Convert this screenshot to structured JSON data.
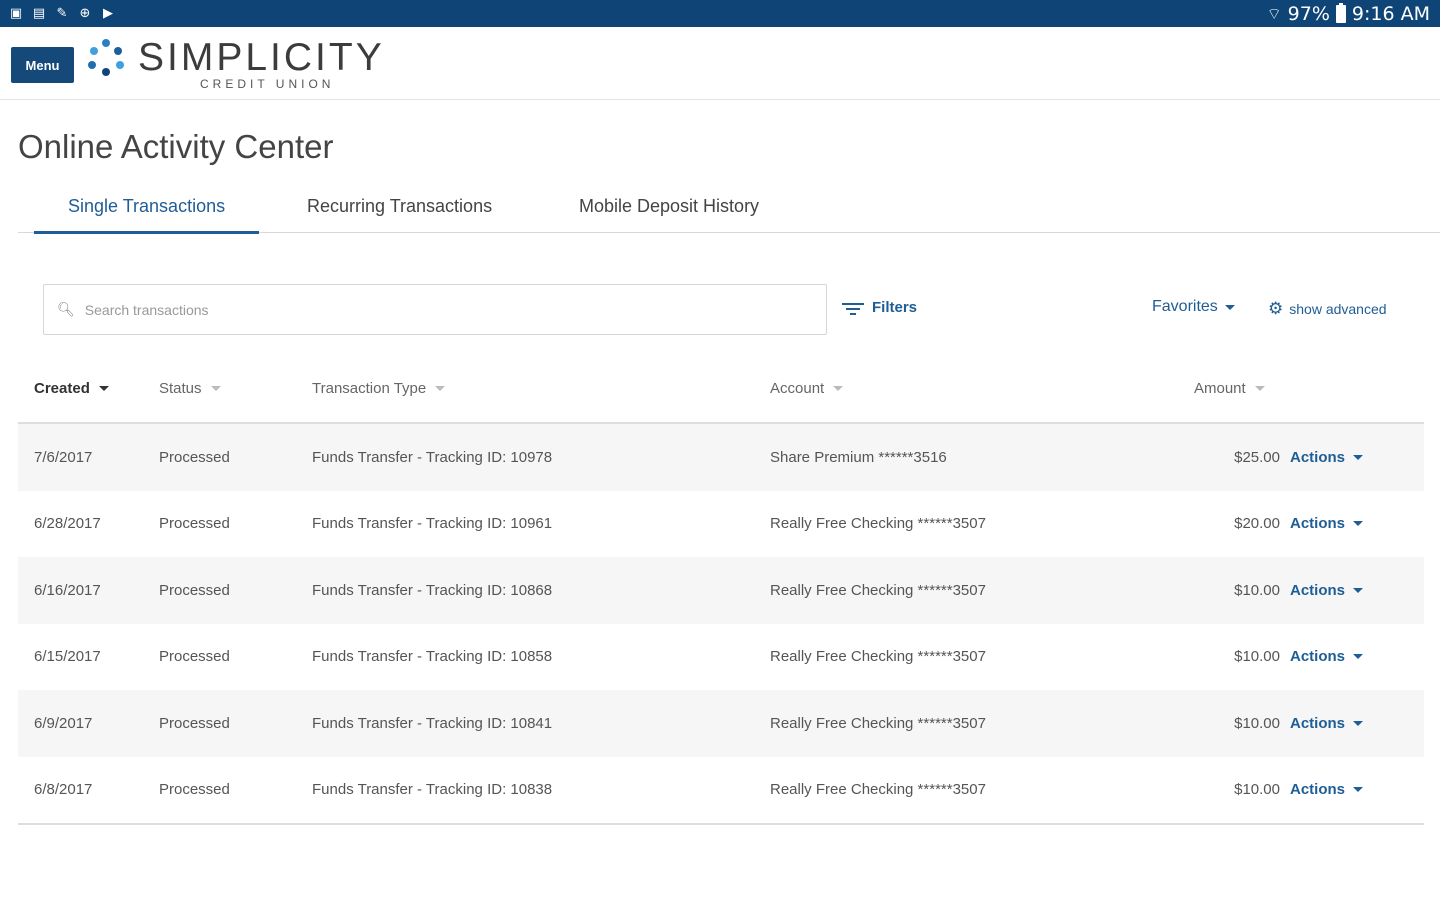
{
  "status_bar": {
    "left_icons": [
      "sim-icon",
      "tablet-icon",
      "edit-icon",
      "globe-icon",
      "play-icon"
    ],
    "battery": "97%",
    "time": "9:16 AM"
  },
  "header": {
    "menu_label": "Menu",
    "logo_name": "SIMPLICITY",
    "logo_sub": "CREDIT UNION"
  },
  "page": {
    "title": "Online Activity Center"
  },
  "tabs": [
    {
      "label": "Single Transactions",
      "active": true
    },
    {
      "label": "Recurring Transactions",
      "active": false
    },
    {
      "label": "Mobile Deposit History",
      "active": false
    }
  ],
  "toolbar": {
    "search_placeholder": "Search transactions",
    "filters_label": "Filters",
    "favorites_label": "Favorites",
    "advanced_label": "show advanced"
  },
  "table": {
    "columns": [
      "Created",
      "Status",
      "Transaction Type",
      "Account",
      "Amount"
    ],
    "action_label": "Actions",
    "rows": [
      {
        "created": "7/6/2017",
        "status": "Processed",
        "type": "Funds Transfer - Tracking ID: 10978",
        "account": "Share Premium ******3516",
        "amount": "$25.00"
      },
      {
        "created": "6/28/2017",
        "status": "Processed",
        "type": "Funds Transfer - Tracking ID: 10961",
        "account": "Really Free Checking ******3507",
        "amount": "$20.00"
      },
      {
        "created": "6/16/2017",
        "status": "Processed",
        "type": "Funds Transfer - Tracking ID: 10868",
        "account": "Really Free Checking ******3507",
        "amount": "$10.00"
      },
      {
        "created": "6/15/2017",
        "status": "Processed",
        "type": "Funds Transfer - Tracking ID: 10858",
        "account": "Really Free Checking ******3507",
        "amount": "$10.00"
      },
      {
        "created": "6/9/2017",
        "status": "Processed",
        "type": "Funds Transfer - Tracking ID: 10841",
        "account": "Really Free Checking ******3507",
        "amount": "$10.00"
      },
      {
        "created": "6/8/2017",
        "status": "Processed",
        "type": "Funds Transfer - Tracking ID: 10838",
        "account": "Really Free Checking ******3507",
        "amount": "$10.00"
      }
    ]
  },
  "colors": {
    "brand_dark": "#0f4576",
    "accent": "#1f5d96"
  }
}
